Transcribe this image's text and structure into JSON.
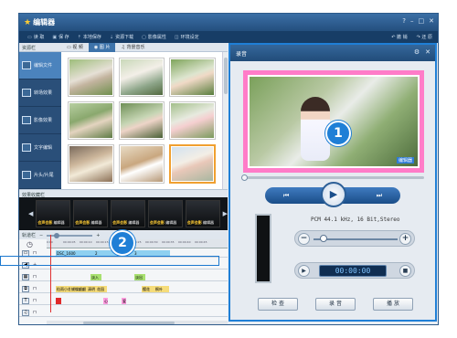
{
  "app": {
    "title": "编辑器",
    "window_controls": [
      "?",
      "–",
      "□",
      "✕"
    ]
  },
  "toolbar": {
    "items": [
      {
        "icon": "folder-icon",
        "label": "读 取"
      },
      {
        "icon": "save-icon",
        "label": "保 存"
      },
      {
        "icon": "upload-icon",
        "label": "本地保存"
      },
      {
        "icon": "download-icon",
        "label": "资源下载"
      },
      {
        "icon": "view-icon",
        "label": "影像属性"
      },
      {
        "icon": "settings-icon",
        "label": "环境设定"
      }
    ],
    "undo_label": "撤 销",
    "redo_label": "还 原"
  },
  "sidebar": {
    "header": "资源栏",
    "items": [
      {
        "label": "编辑文件",
        "active": true
      },
      {
        "label": "转场效果",
        "active": false
      },
      {
        "label": "影像效果",
        "active": false
      },
      {
        "label": "文字编辑",
        "active": false
      },
      {
        "label": "片头/片尾",
        "active": false
      }
    ]
  },
  "tabs": [
    {
      "label": "视 频",
      "active": false
    },
    {
      "label": "图 片",
      "active": true
    },
    {
      "label": "背景音乐",
      "active": false
    }
  ],
  "gallery": {
    "thumbnail_count": 9,
    "selected_index": 8
  },
  "favorites": {
    "header": "效果收藏栏",
    "items": [
      {
        "brand": "会声会影",
        "label": "编辑器"
      },
      {
        "brand": "会声会影",
        "label": "编辑器"
      },
      {
        "brand": "会声会影",
        "label": "编辑器"
      },
      {
        "brand": "会声会影",
        "label": "编辑器"
      },
      {
        "brand": "会声会影",
        "label": "编辑器"
      }
    ]
  },
  "timeline": {
    "header": "轨道栏",
    "ruler_ticks": [
      "0:00",
      "00:00:05",
      "00:00:10",
      "00:00:15",
      "00:00:20",
      "00:00:25",
      "00:00:30",
      "00:00:35",
      "00:00:40",
      "00:00:45"
    ],
    "tracks": [
      {
        "icon": "video-track-icon",
        "clips": [
          {
            "label": "DSC_1600",
            "color": "#8fd0f0",
            "start": 10,
            "width": 42
          },
          {
            "label": "2",
            "color": "#8fd0f0",
            "start": 52,
            "width": 43
          },
          {
            "label": "3",
            "color": "#8fd0f0",
            "start": 95,
            "width": 40
          }
        ]
      },
      {
        "icon": "audio-track-icon",
        "clips": []
      },
      {
        "icon": "effect-track-icon",
        "clips": [
          {
            "label": "淡入",
            "color": "#a8e070",
            "start": 48,
            "width": 12
          },
          {
            "label": "淡出",
            "color": "#a8e070",
            "start": 96,
            "width": 12
          }
        ]
      },
      {
        "icon": "transition-track-icon",
        "clips": [
          {
            "label": "粒雨小花",
            "color": "#f5dc7a",
            "start": 10,
            "width": 16
          },
          {
            "label": "蝴蝶翩翩",
            "color": "#f5dc7a",
            "start": 26,
            "width": 18
          },
          {
            "label": "清明",
            "color": "#f5dc7a",
            "start": 44,
            "width": 10
          },
          {
            "label": "花园",
            "color": "#f5dc7a",
            "start": 54,
            "width": 12
          },
          {
            "label": "樱花",
            "color": "#f5dc7a",
            "start": 104,
            "width": 14
          },
          {
            "label": "枫叶",
            "color": "#f5dc7a",
            "start": 118,
            "width": 16
          }
        ]
      },
      {
        "icon": "text-track-icon",
        "clips": [
          {
            "label": "",
            "color": "#e02a2a",
            "start": 10,
            "width": 6
          },
          {
            "label": "心",
            "color": "#ff9de0",
            "start": 62,
            "width": 5
          },
          {
            "label": "爱",
            "color": "#ff9de0",
            "start": 82,
            "width": 5
          }
        ]
      },
      {
        "icon": "music-track-icon",
        "clips": []
      }
    ]
  },
  "badges": {
    "one": "1",
    "two": "2"
  },
  "dialog": {
    "title": "录音",
    "controls": [
      "⚙",
      "✕"
    ],
    "preview_logo": "编辑器",
    "audio_format": "PCM 44.1 kHz, 16 Bit,Stereo",
    "volume_minus": "−",
    "volume_plus": "+",
    "time": "00:00:00",
    "buttons": {
      "check": "检 查",
      "record": "录 音",
      "play": "播 放"
    },
    "volume_level": 0.07,
    "progress_level": 0.0
  },
  "colors": {
    "accent": "#1f7fd6",
    "titlebar": "#2d5a8a",
    "preview_frame": "#ff7cc8",
    "sidebar": "#2a4f79"
  }
}
